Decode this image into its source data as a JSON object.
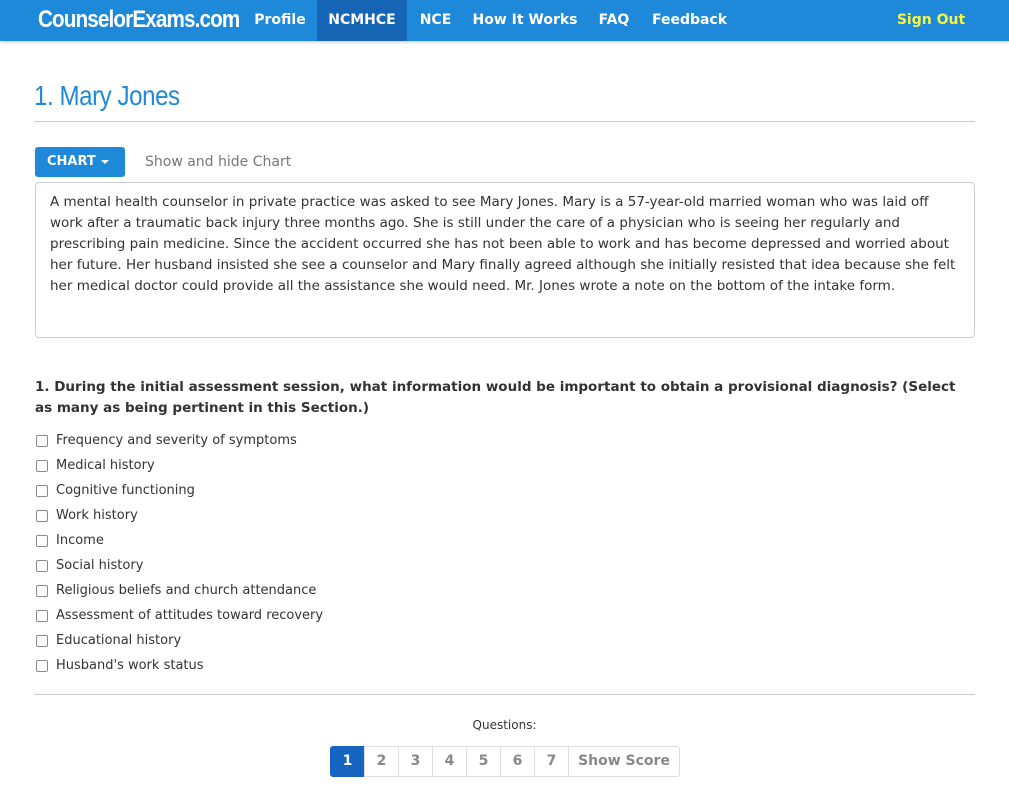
{
  "navbar": {
    "brand": "CounselorExams.com",
    "items": [
      {
        "label": "Profile"
      },
      {
        "label": "NCMHCE"
      },
      {
        "label": "NCE"
      },
      {
        "label": "How It Works"
      },
      {
        "label": "FAQ"
      },
      {
        "label": "Feedback"
      }
    ],
    "active": "NCMHCE",
    "sign_out": "Sign Out"
  },
  "page": {
    "title": "1. Mary Jones"
  },
  "chart": {
    "button_label": "CHART",
    "hint": "Show and hide Chart"
  },
  "scenario": {
    "text": "A mental health counselor in private practice was asked to see Mary Jones. Mary is a 57-year-old married woman who was laid off work after a traumatic back injury three months ago. She is still under the care of a physician who is seeing her regularly and prescribing pain medicine. Since the accident occurred she has not been able to work and has become depressed and worried about her future. Her husband insisted she see a counselor and Mary finally agreed although she initially resisted that idea because she felt her medical doctor could provide all the assistance she would need. Mr. Jones wrote a note on the bottom of the intake form."
  },
  "question": {
    "text": "1. During the initial assessment session, what information would be important to obtain a provisional diagnosis? (Select as many as being pertinent in this Section.)",
    "options": [
      {
        "label": "Frequency and severity of symptoms",
        "checked": false
      },
      {
        "label": "Medical history",
        "checked": false
      },
      {
        "label": "Cognitive functioning",
        "checked": false
      },
      {
        "label": "Work history",
        "checked": false
      },
      {
        "label": "Income",
        "checked": false
      },
      {
        "label": "Social history",
        "checked": false
      },
      {
        "label": "Religious beliefs and church attendance",
        "checked": false
      },
      {
        "label": "Assessment of attitudes toward recovery",
        "checked": false
      },
      {
        "label": "Educational history",
        "checked": false
      },
      {
        "label": "Husband's work status",
        "checked": false
      }
    ]
  },
  "pagination": {
    "label": "Questions:",
    "pages": [
      "1",
      "2",
      "3",
      "4",
      "5",
      "6",
      "7"
    ],
    "current": "1",
    "show_score": "Show Score"
  },
  "colors": {
    "primary": "#1e88d9",
    "active_nav": "#1565b4",
    "sign_out": "#f5f542",
    "active_page": "#1565c0"
  }
}
